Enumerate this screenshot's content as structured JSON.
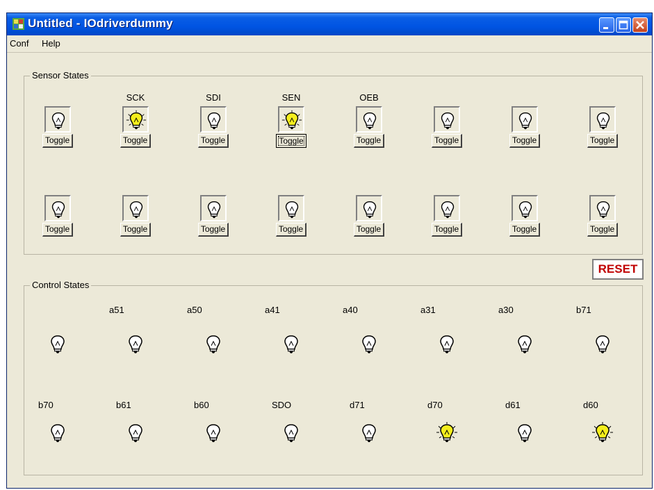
{
  "window": {
    "title": "Untitled - IOdriverdummy"
  },
  "menu": {
    "items": [
      "Conf",
      "Help"
    ]
  },
  "sensor": {
    "title": "Sensor States",
    "toggle_label": "Toggle",
    "labels": [
      "",
      "SCK",
      "SDI",
      "SEN",
      "OEB",
      "",
      "",
      ""
    ],
    "row1_lit": [
      false,
      true,
      false,
      true,
      false,
      false,
      false,
      false
    ],
    "row2_lit": [
      false,
      false,
      false,
      false,
      false,
      false,
      false,
      false
    ]
  },
  "reset_label": "RESET",
  "control": {
    "title": "Control States",
    "row1_labels": [
      "",
      "a51",
      "a50",
      "a41",
      "a40",
      "a31",
      "a30",
      "b71"
    ],
    "row2_labels": [
      "b70",
      "b61",
      "b60",
      "SDO",
      "d71",
      "d70",
      "d61",
      "d60"
    ],
    "row1_lit": [
      false,
      false,
      false,
      false,
      false,
      false,
      false,
      false
    ],
    "row2_lit": [
      false,
      false,
      false,
      false,
      false,
      true,
      false,
      true
    ]
  },
  "colors": {
    "lit": "#f5ee1c",
    "unlit": "#ffffff",
    "title_bar": "#0054e3",
    "reset_text": "#c00000"
  }
}
